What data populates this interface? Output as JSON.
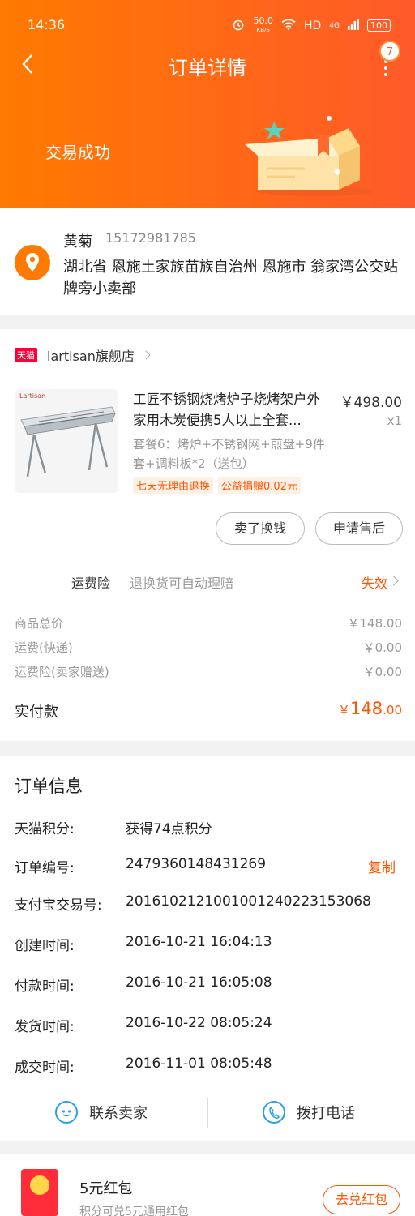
{
  "status_bar": {
    "time": "14:36",
    "speed": "50.0",
    "speed_unit": "KB/S",
    "hd": "HD",
    "network": "4G",
    "battery": "100"
  },
  "header": {
    "title": "订单详情",
    "badge": "7",
    "status_text": "交易成功"
  },
  "address": {
    "name": "黄菊",
    "phone": "15172981785",
    "detail": "湖北省 恩施土家族苗族自治州 恩施市 翁家湾公交站牌旁小卖部"
  },
  "shop": {
    "tag": "天猫",
    "name": "lartisan旗舰店"
  },
  "product": {
    "thumb_brand": "Lartisan",
    "title": "工匠不锈钢烧烤炉子烧烤架户外家用木炭便携5人以上全套...",
    "price": "￥498.00",
    "qty": "x1",
    "spec": "套餐6：烤炉+不锈钢网+煎盘+9件套+调料板*2（送包）",
    "tags": [
      "七天无理由退换",
      "公益捐赠0.02元"
    ]
  },
  "actions": {
    "sell": "卖了换钱",
    "after_sale": "申请售后"
  },
  "insurance": {
    "label": "运费险",
    "desc": "退换货可自动理赔",
    "status": "失效"
  },
  "fees": [
    {
      "label": "商品总价",
      "value": "￥148.00"
    },
    {
      "label": "运费(快递)",
      "value": "￥0.00"
    },
    {
      "label": "运费险(卖家赠送)",
      "value": "￥0.00"
    }
  ],
  "total": {
    "label": "实付款",
    "currency": "￥",
    "int": "148",
    "dec": ".00"
  },
  "order_info": {
    "title": "订单信息",
    "rows": [
      {
        "key": "天猫积分:",
        "value": "获得74点积分"
      },
      {
        "key": "订单编号:",
        "value": "2479360148431269",
        "action": "复制"
      },
      {
        "key": "支付宝交易号:",
        "value": "2016102121001001240223153068"
      },
      {
        "key": "创建时间:",
        "value": "2016-10-21 16:04:13"
      },
      {
        "key": "付款时间:",
        "value": "2016-10-21 16:05:08"
      },
      {
        "key": "发货时间:",
        "value": "2016-10-22 08:05:24"
      },
      {
        "key": "成交时间:",
        "value": "2016-11-01 08:05:48"
      }
    ],
    "contact_seller": "联系卖家",
    "call_phone": "拨打电话"
  },
  "promo": {
    "title": "5元红包",
    "subtitle": "积分可兑5元通用红包",
    "button": "去兑红包"
  },
  "colors": {
    "accent": "#ff5500",
    "header_start": "#ff7a00",
    "header_end": "#ff5a2a",
    "icon_blue": "#29a1e3"
  }
}
